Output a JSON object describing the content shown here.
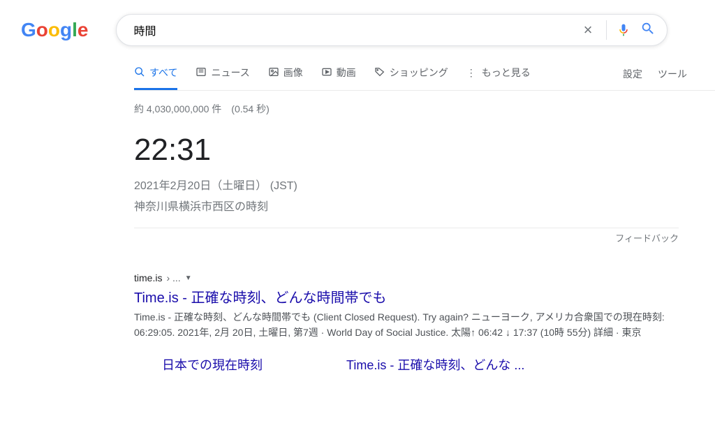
{
  "logo": {
    "g1": "G",
    "o1": "o",
    "o2": "o",
    "g2": "g",
    "l": "l",
    "e": "e"
  },
  "search": {
    "value": "時間"
  },
  "tabs": {
    "all": "すべて",
    "news": "ニュース",
    "images": "画像",
    "videos": "動画",
    "shopping": "ショッピング",
    "more": "もっと見る"
  },
  "controls": {
    "settings": "設定",
    "tools": "ツール"
  },
  "stats": "約 4,030,000,000 件　(0.54 秒)",
  "time": {
    "clock": "22:31",
    "date": "2021年2月20日（土曜日）  (JST)",
    "location": "神奈川県横浜市西区の時刻"
  },
  "feedback": "フィードバック",
  "result": {
    "domain": "time.is",
    "path": " › ...",
    "title": "Time.is - 正確な時刻、どんな時間帯でも",
    "desc": "Time.is - 正確な時刻、どんな時間帯でも (Client Closed Request). Try again? ニューヨーク, アメリカ合衆国での現在時刻: 06:29:05. 2021年, 2月 20日, 土曜日, 第7週 · World Day of Social Justice. 太陽↑ 06:42 ↓ 17:37 (10時 55分) 詳細 · 東京"
  },
  "related": {
    "a": "日本での現在時刻",
    "b": "Time.is - 正確な時刻、どんな ..."
  }
}
